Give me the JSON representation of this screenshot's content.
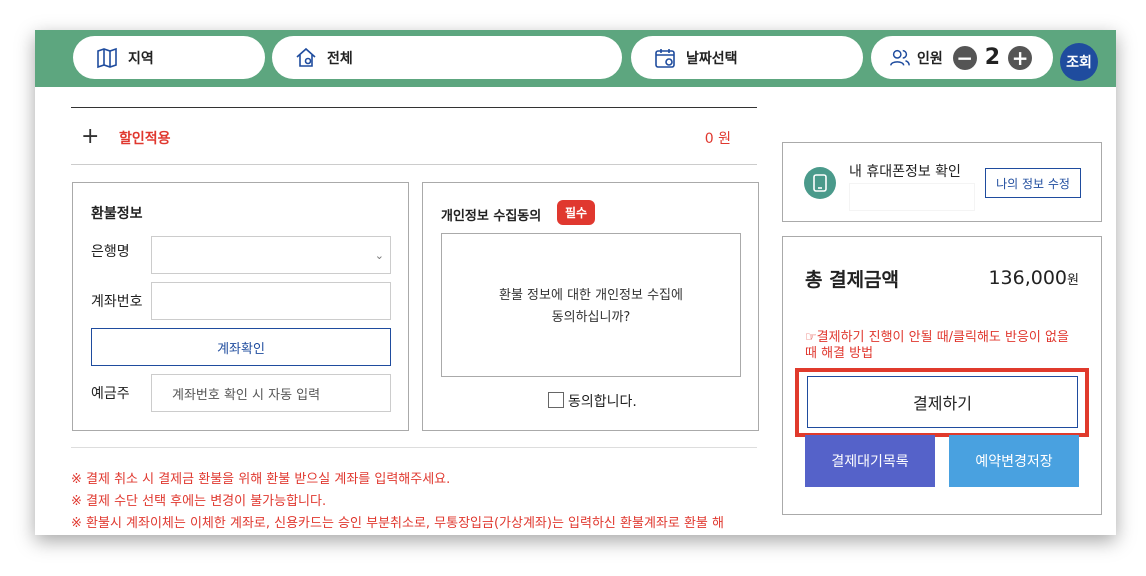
{
  "topbar": {
    "region_label": "지역",
    "all_label": "전체",
    "date_label": "날짜선택",
    "people_label": "인원",
    "people_count": "2",
    "minus_symbol": "−",
    "plus_symbol": "+",
    "search_label": "조회",
    "bar_color": "#5da67f"
  },
  "discount": {
    "plus_symbol": "+",
    "label": "할인적용",
    "amount": "0 원"
  },
  "refund": {
    "title": "환불정보",
    "bank_label": "은행명",
    "bank_selected": "",
    "account_label": "계좌번호",
    "account_value": "",
    "verify_button": "계좌확인",
    "holder_label": "예금주",
    "holder_placeholder": "계좌번호 확인 시 자동 입력"
  },
  "consent": {
    "title": "개인정보 수집동의",
    "badge": "필수",
    "text_line1": "환불 정보에 대한 개인정보 수집에",
    "text_line2": "동의하십니까?",
    "agree_label": "동의합니다."
  },
  "notices": [
    "※ 결제 취소 시 결제금 환불을 위해 환불 받으실 계좌를 입력해주세요.",
    "※ 결제 수단 선택 후에는 변경이 불가능합니다.",
    "※ 환불시 계좌이체는 이체한 계좌로, 신용카드는 승인 부분취소로, 무통장입금(가상계좌)는 입력하신 환불계좌로 환불 해"
  ],
  "phone": {
    "label": "내 휴대폰정보 확인",
    "edit_button": "나의 정보 수정"
  },
  "payment": {
    "total_label": "총 결제금액",
    "total_amount": "136,000",
    "currency": "원",
    "help_text": "☞결제하기 진행이 안될 때/클릭해도 반응이 없을 때 해결 방법",
    "pay_button": "결제하기",
    "waitlist_button": "결제대기목록",
    "save_button": "예약변경저장",
    "accent_red": "#e03a2c",
    "waitlist_color": "#5562c9",
    "save_color": "#49a1e0"
  }
}
